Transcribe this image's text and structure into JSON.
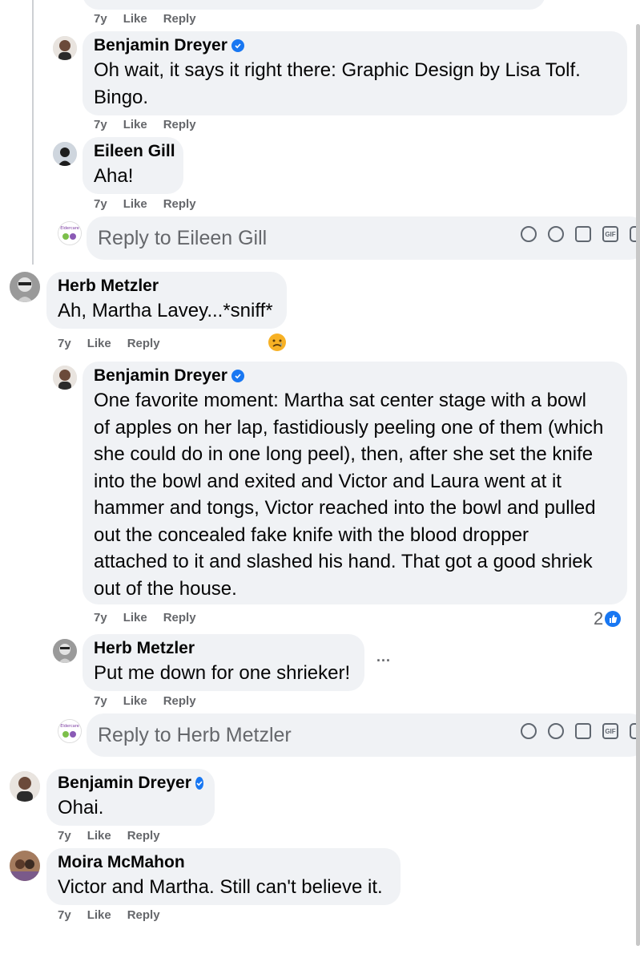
{
  "actions": {
    "like": "Like",
    "reply": "Reply"
  },
  "top_meta": {
    "time": "7y"
  },
  "comments": [
    {
      "name": "Benjamin Dreyer",
      "verified": true,
      "lines": [
        "Oh wait, it says it right there: Graphic Design by Lisa Tolf.",
        "Bingo."
      ],
      "time": "7y"
    },
    {
      "name": "Eileen Gill",
      "lines": [
        "Aha!"
      ],
      "time": "7y"
    },
    {
      "name": "Herb Metzler",
      "lines": [
        "Ah, Martha Lavey...*sniff*"
      ],
      "time": "7y",
      "reaction": "sad-face"
    },
    {
      "name": "Benjamin Dreyer",
      "verified": true,
      "lines": [
        "One favorite moment: Martha sat center stage with a bowl",
        "of apples on her lap, fastidiously peeling one of them (which",
        "she could do in one long peel), then, after she set the knife",
        "into the bowl and exited and Victor and Laura went at it",
        "hammer and tongs, Victor reached into the bowl and pulled",
        "out the concealed fake knife with the blood dropper",
        "attached to it and slashed his hand. That got a good shriek",
        "out of the house."
      ],
      "time": "7y",
      "reaction_count": "2"
    },
    {
      "name": "Herb Metzler",
      "lines": [
        "Put me down for one shrieker!"
      ],
      "time": "7y",
      "more": "..."
    },
    {
      "name": "Benjamin Dreyer",
      "verified": true,
      "lines": [
        "Ohai."
      ],
      "time": "7y"
    },
    {
      "name": "Moira McMahon",
      "lines": [
        "Victor and Martha. Still can't believe it."
      ],
      "time": "7y"
    }
  ],
  "reply_boxes": [
    {
      "placeholder": "Reply to Eileen Gill",
      "avatar_text": "Eldercare"
    },
    {
      "placeholder": "Reply to Herb Metzler",
      "avatar_text": "Eldercare"
    }
  ],
  "tools": [
    "sticker-icon",
    "emoji-icon",
    "camera-icon",
    "gif-icon",
    "avatar-sticker-icon"
  ],
  "tools_gif": "GIF",
  "colors": {
    "bubble": "#f0f2f5",
    "meta": "#65676b",
    "verified": "#1877f2"
  }
}
